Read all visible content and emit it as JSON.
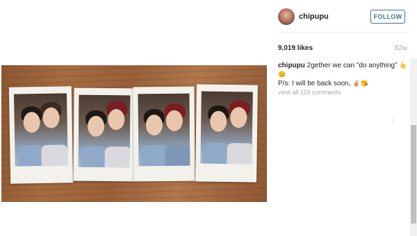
{
  "post": {
    "username": "chipupu",
    "follow_label": "FOLLOW",
    "likes": "9,019 likes",
    "age": "82w",
    "caption_user": "chipupu",
    "caption_line1": "2gether we can \"do anything\"",
    "caption_line1_emoji": "👆",
    "caption_line2_emoji_a": "😊",
    "caption_line3": "P/s: I will be back soon,",
    "caption_line3_emoji": "✌🏼😘",
    "view_all": "view all 119 comments"
  },
  "colors": {
    "follow_blue": "#3f729b",
    "muted_gray": "#a5a7aa"
  }
}
